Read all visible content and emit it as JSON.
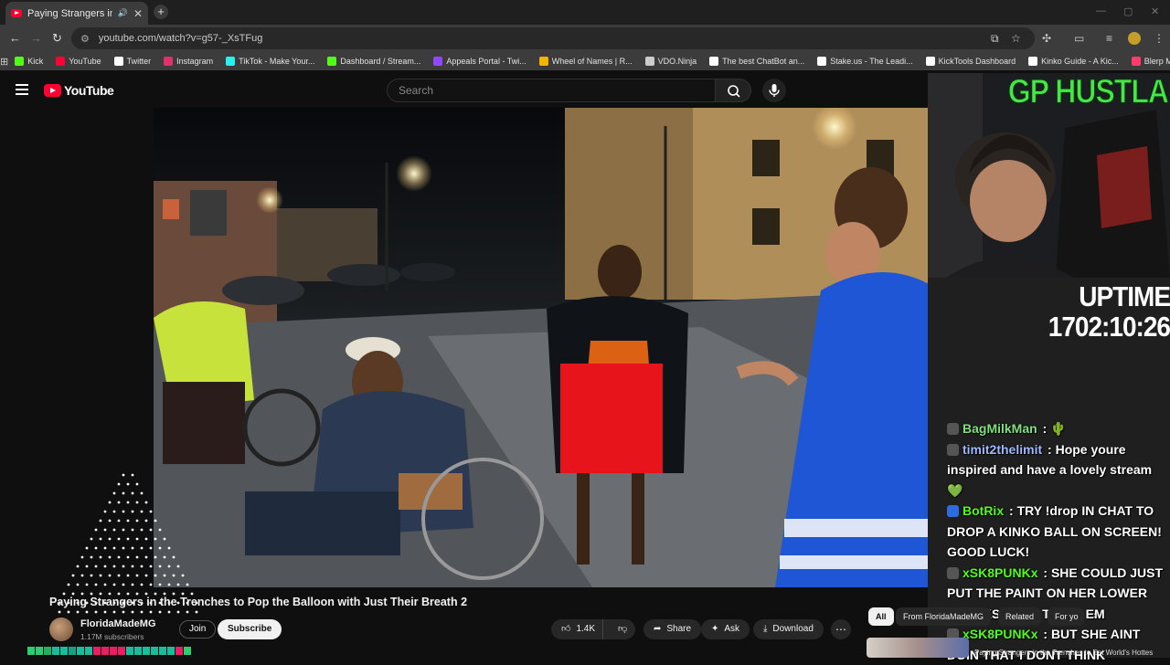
{
  "browser": {
    "tab_title": "Paying Strangers in the Tren",
    "new_tab_label": "+",
    "url": "youtube.com/watch?v=g57-_XsTFug",
    "bookmarks": [
      {
        "label": "Kick",
        "color": "#53fc18"
      },
      {
        "label": "YouTube",
        "color": "#ff0033"
      },
      {
        "label": "Twitter",
        "color": "#ffffff"
      },
      {
        "label": "Instagram",
        "color": "#e1306c"
      },
      {
        "label": "TikTok - Make Your...",
        "color": "#25f4ee"
      },
      {
        "label": "Dashboard / Stream...",
        "color": "#53fc18"
      },
      {
        "label": "Appeals Portal - Twi...",
        "color": "#9146ff"
      },
      {
        "label": "Wheel of Names | R...",
        "color": "#f4b400"
      },
      {
        "label": "VDO.Ninja",
        "color": "#cccccc"
      },
      {
        "label": "The best ChatBot an...",
        "color": "#ffffff"
      },
      {
        "label": "Stake.us - The Leadi...",
        "color": "#ffffff"
      },
      {
        "label": "KickTools Dashboard",
        "color": "#ffffff"
      },
      {
        "label": "Kinko Guide - A Kic...",
        "color": "#ffffff"
      },
      {
        "label": "Blerp Memes | Best...",
        "color": "#ff3b6b"
      }
    ]
  },
  "youtube": {
    "logo_text": "YouTube",
    "search_placeholder": "Search",
    "video_title": "Paying Strangers in the Trenches to Pop the Balloon with Just Their Breath 2",
    "channel_name": "FloridaMadeMG",
    "subscribers": "1.17M subscribers",
    "join_label": "Join",
    "subscribe_label": "Subscribe",
    "likes": "1.4K",
    "share_label": "Share",
    "ask_label": "Ask",
    "download_label": "Download",
    "chips": [
      "All",
      "From FloridaMadeMG",
      "Related",
      "For yo"
    ],
    "next_video_title": "Paying Strangers in the Trenches to Eat World's Hottes"
  },
  "stream_overlay": {
    "webcam_title": "GP HUSTLA",
    "uptime_label": "UPTIME",
    "uptime_value": "1702:10:26",
    "chat": [
      {
        "user": "BagMilkMan",
        "color": "#7fe07f",
        "message": "🌵"
      },
      {
        "user": "timit2thelimit",
        "color": "#9fb8ff",
        "message": "Hope youre inspired and have a lovely stream 💚"
      },
      {
        "user": "BotRix",
        "color": "#53fc18",
        "message": "TRY !drop IN CHAT TO DROP A KINKO BALL ON SCREEN! GOOD LUCK!"
      },
      {
        "user": "xSK8PUNKx",
        "color": "#53fc18",
        "message": "SHE COULD JUST PUT THE PAINT ON HER LOWER CHEEKS THEN TWIST EM"
      },
      {
        "user": "xSK8PUNKx",
        "color": "#53fc18",
        "message": "BUT SHE AINT DOIN THAT I DONT THINK"
      }
    ]
  },
  "color_strip": [
    "#2ecc71",
    "#2ecc71",
    "#27ae60",
    "#1abc9c",
    "#1abc9c",
    "#16a085",
    "#1abc9c",
    "#1abc9c",
    "#e91e63",
    "#e91e63",
    "#e91e63",
    "#e91e63",
    "#1abc9c",
    "#1abc9c",
    "#1abc9c",
    "#1abc9c",
    "#1abc9c",
    "#1abc9c",
    "#e91e63",
    "#2ecc71"
  ]
}
